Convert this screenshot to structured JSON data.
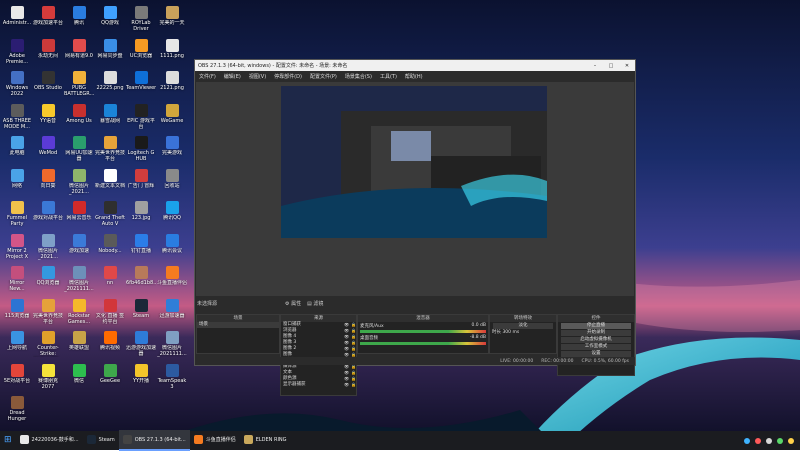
{
  "desktop_icons": [
    {
      "label": "Administr...",
      "color": "#e8e8e8"
    },
    {
      "label": "游戏加速平台",
      "color": "#d43b3b"
    },
    {
      "label": "腾讯",
      "color": "#2a7de1"
    },
    {
      "label": "QQ游戏",
      "color": "#3fa0ff"
    },
    {
      "label": "ROYLab Driver",
      "color": "#7a7a7a"
    },
    {
      "label": "完美的一天",
      "color": "#c9a15b"
    },
    {
      "label": "Adobe Premie...",
      "color": "#2b1d72"
    },
    {
      "label": "永劫无间",
      "color": "#cc3a3a"
    },
    {
      "label": "网易有道9.0",
      "color": "#e04c4c"
    },
    {
      "label": "网易同步盘",
      "color": "#3a8ee6"
    },
    {
      "label": "UC浏览器",
      "color": "#f59a23"
    },
    {
      "label": "1111.png",
      "color": "#e6e6e6"
    },
    {
      "label": "Windows 2022",
      "color": "#4470c4"
    },
    {
      "label": "OBS Studio",
      "color": "#333333"
    },
    {
      "label": "PUBG BATTLEGR...",
      "color": "#f1b13a"
    },
    {
      "label": "22225.png",
      "color": "#dddddd"
    },
    {
      "label": "TeamViewer",
      "color": "#0e6fd8"
    },
    {
      "label": "2121.png",
      "color": "#dddddd"
    },
    {
      "label": "ASB THREE MODE M...",
      "color": "#5c5c5c"
    },
    {
      "label": "YY语音",
      "color": "#f7c92b"
    },
    {
      "label": "Among Us",
      "color": "#c8302e"
    },
    {
      "label": "暴雪战网",
      "color": "#1b84d8"
    },
    {
      "label": "EPIC 游戏平台",
      "color": "#222222"
    },
    {
      "label": "WeGame",
      "color": "#d1a63c"
    },
    {
      "label": "此电脑",
      "color": "#4aa3e8"
    },
    {
      "label": "WeMod",
      "color": "#5b3bd6"
    },
    {
      "label": "网易UU加速器",
      "color": "#2a9e6d"
    },
    {
      "label": "完美世界竞技平台",
      "color": "#e6a33a"
    },
    {
      "label": "Logitech G HUB",
      "color": "#1a1a1a"
    },
    {
      "label": "完美游戏",
      "color": "#3a72d8"
    },
    {
      "label": "网络",
      "color": "#4aa3e8"
    },
    {
      "label": "向日葵",
      "color": "#f0692c"
    },
    {
      "label": "微信图片_2021...",
      "color": "#8fb56b"
    },
    {
      "label": "新建文本文档",
      "color": "#ffffff"
    },
    {
      "label": "广告门 冒辉",
      "color": "#d23d3d"
    },
    {
      "label": "回收站",
      "color": "#8a8a8a"
    },
    {
      "label": "Fummel Party",
      "color": "#f1c14b"
    },
    {
      "label": "游戏对战平台",
      "color": "#3b79d6"
    },
    {
      "label": "网易云音乐",
      "color": "#d12a2a"
    },
    {
      "label": "Grand Theft Auto V",
      "color": "#2f2f2f"
    },
    {
      "label": "123.jpg",
      "color": "#a0a0a0"
    },
    {
      "label": "腾讯QQ",
      "color": "#1aa1ea"
    },
    {
      "label": "Mirror 2 Project X",
      "color": "#d35588"
    },
    {
      "label": "微信图片_2021...",
      "color": "#7ea0c8"
    },
    {
      "label": "游戏加速",
      "color": "#3b7ad8"
    },
    {
      "label": "Nobody...",
      "color": "#5a5a5a"
    },
    {
      "label": "钉钉直播",
      "color": "#2b7de8"
    },
    {
      "label": "腾讯会议",
      "color": "#2a7de1"
    },
    {
      "label": "Mirror New...",
      "color": "#c44f7d"
    },
    {
      "label": "QQ浏览器",
      "color": "#3498e0"
    },
    {
      "label": "微信图片_2021111...",
      "color": "#6d90b9"
    },
    {
      "label": "nn",
      "color": "#e04848"
    },
    {
      "label": "6fb46d1b8...",
      "color": "#b87a5a"
    },
    {
      "label": "斗鱼直播伴侣",
      "color": "#f57b20"
    },
    {
      "label": "115浏览器",
      "color": "#2d74d3"
    },
    {
      "label": "完美世界竞技平台",
      "color": "#e5a23a"
    },
    {
      "label": "Rockstar Games...",
      "color": "#f5b82a"
    },
    {
      "label": "文化 直播 签约平台",
      "color": "#d2363b"
    },
    {
      "label": "Steam",
      "color": "#1b2838"
    },
    {
      "label": "迅游加速器",
      "color": "#2f7ed8"
    },
    {
      "label": "上网导航",
      "color": "#3a93e2"
    },
    {
      "label": "Counter-Strike: Global Off...",
      "color": "#e0a12b"
    },
    {
      "label": "英雄联盟",
      "color": "#c8a347"
    },
    {
      "label": "腾讯视频",
      "color": "#ff6b00"
    },
    {
      "label": "迅游游戏加速器",
      "color": "#2e7bd8"
    },
    {
      "label": "微信图片_2021111...",
      "color": "#7f9fc2"
    },
    {
      "label": "5E对战平台",
      "color": "#e3453a"
    },
    {
      "label": "赛博朋克 2077",
      "color": "#f5e33a"
    },
    {
      "label": "微信",
      "color": "#2dbe4e"
    },
    {
      "label": "GeeGee",
      "color": "#3ea84b"
    },
    {
      "label": "YY开播",
      "color": "#f4c52a"
    },
    {
      "label": "TeamSpeak 3",
      "color": "#2c5aa0"
    },
    {
      "label": "Dread Hunger",
      "color": "#8a5a3a"
    }
  ],
  "obs": {
    "title": "OBS 27.1.3 (64-bit, windows) - 配置文件: 未命名 - 场景: 未命名",
    "menu": [
      "文件(F)",
      "编辑(E)",
      "视图(V)",
      "停靠部件(D)",
      "配置文件(P)",
      "场景集合(S)",
      "工具(T)",
      "帮助(H)"
    ],
    "scene_label": "未选择源",
    "props_button": "属性",
    "filters_button": "滤镜",
    "docks": {
      "scenes": {
        "title": "场景",
        "items": [
          "场景"
        ]
      },
      "sources": {
        "title": "来源",
        "items": [
          "窗口捕获",
          "浏览器",
          "图像 4",
          "图像 3",
          "图像 2",
          "图像",
          "视频捕获设备",
          "媒体源",
          "文本",
          "颜色源",
          "显示器捕获"
        ]
      },
      "mixer": {
        "title": "混音器",
        "tracks": [
          {
            "name": "麦克风/Aux",
            "level": "0.0 dB"
          },
          {
            "name": "桌面音频",
            "level": "-8.8 dB"
          }
        ]
      },
      "transitions": {
        "title": "转场特效",
        "type": "淡化",
        "duration_label": "时长",
        "duration": "300 ms"
      },
      "controls": {
        "title": "控件",
        "buttons": [
          "停止直播",
          "开始录制",
          "启动虚拟摄像机",
          "工作室模式",
          "设置",
          "退出"
        ]
      }
    },
    "status": {
      "live": "LIVE: 00:00:00",
      "rec": "REC: 00:00:00",
      "cpu": "CPU: 0.5%, 60.00 fps"
    }
  },
  "taskbar": {
    "apps": [
      {
        "label": "24220036-鼓手和...",
        "color": "#e8e8e8",
        "active": false
      },
      {
        "label": "Steam",
        "color": "#1b2838",
        "active": false
      },
      {
        "label": "OBS 27.1.3 (64-bit...",
        "color": "#444444",
        "active": true
      },
      {
        "label": "斗鱼直播伴侣",
        "color": "#f57b20",
        "active": false
      },
      {
        "label": "ELDEN RING",
        "color": "#c9a85c",
        "active": false
      }
    ],
    "tray_colors": [
      "#3fb3ff",
      "#ff5a5a",
      "#d8d8d8",
      "#5ad86a",
      "#ffd24a"
    ]
  }
}
